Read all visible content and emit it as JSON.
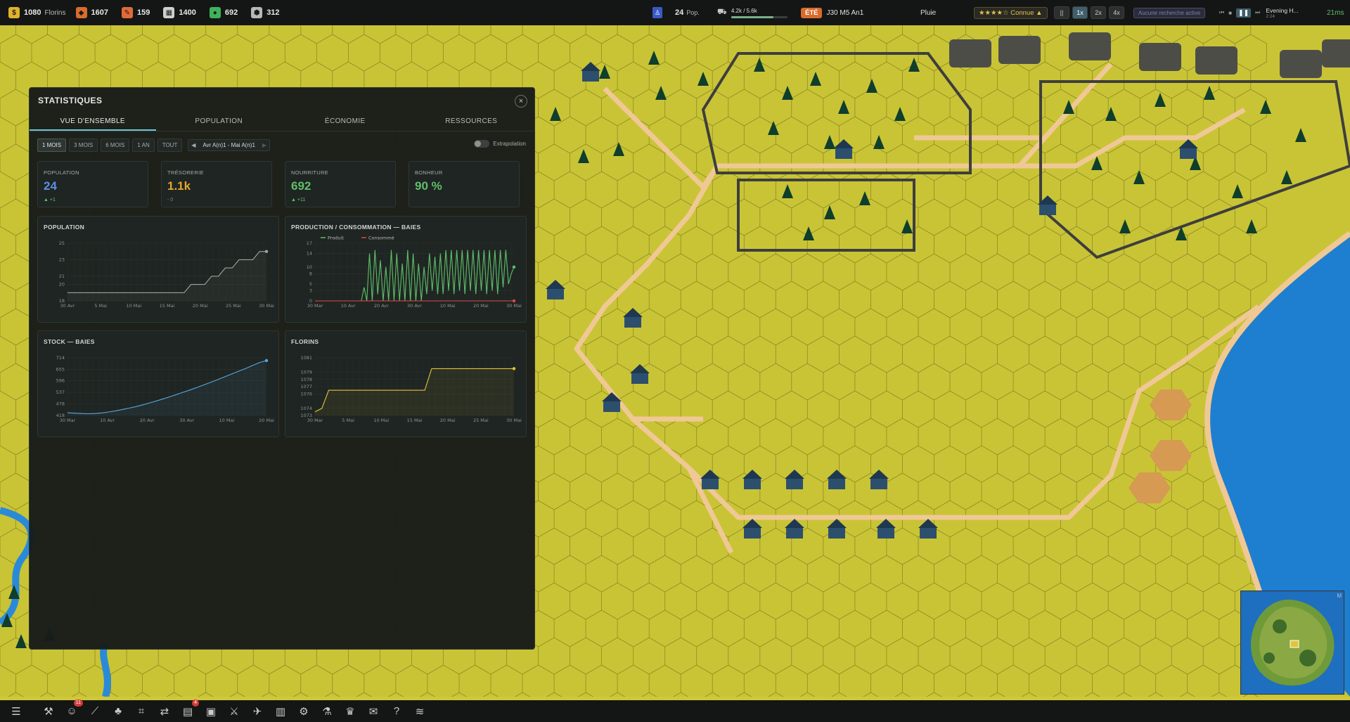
{
  "topbar": {
    "resources": [
      {
        "name": "florins",
        "icon": "coin-icon",
        "color": "#e0b22c",
        "value": "1080",
        "unit": "Florins"
      },
      {
        "name": "wood",
        "icon": "wood-icon",
        "color": "#d86c2c",
        "value": "1607",
        "unit": ""
      },
      {
        "name": "tools",
        "icon": "tools-icon",
        "color": "#e06a3a",
        "value": "159",
        "unit": ""
      },
      {
        "name": "stone",
        "icon": "stone-icon",
        "color": "#cfcfcf",
        "value": "1400",
        "unit": ""
      },
      {
        "name": "food",
        "icon": "food-icon",
        "color": "#3fb35a",
        "value": "692",
        "unit": ""
      },
      {
        "name": "metal",
        "icon": "metal-icon",
        "color": "#b8b8b8",
        "value": "312",
        "unit": ""
      }
    ],
    "population": {
      "value": "24",
      "unit": "Pop."
    },
    "storage": "4.2k / 5.6k",
    "season": "ÉTÉ",
    "date": "J30 M5 An1",
    "weather": "Pluie",
    "reputation": "★★★★☆ Connue ▲",
    "speed": {
      "pause": "||",
      "options": [
        "1x",
        "2x",
        "4x"
      ],
      "active": "1x"
    },
    "research": "Aucune recherche active",
    "track": {
      "title": "Evening H...",
      "time": "2:24"
    },
    "timer": "21ms"
  },
  "panel": {
    "title": "STATISTIQUES",
    "close": "×",
    "tabs": [
      "VUE D'ENSEMBLE",
      "POPULATION",
      "ÉCONOMIE",
      "RESSOURCES"
    ],
    "ranges": [
      "1 MOIS",
      "3 MOIS",
      "6 MOIS",
      "1 AN",
      "TOUT"
    ],
    "active_range": "1 MOIS",
    "period": "Avr A(n)1 - Mai A(n)1",
    "extrapolation": "Extrapolation",
    "cards": [
      {
        "label": "POPULATION",
        "value": "24",
        "delta": "▲ +1",
        "color": "#5b8ee6"
      },
      {
        "label": "TRÉSORERIE",
        "value": "1.1k",
        "delta": "- 0",
        "color": "#e3a82a"
      },
      {
        "label": "NOURRITURE",
        "value": "692",
        "delta": "▲ +11",
        "color": "#5fbf6a"
      },
      {
        "label": "BONHEUR",
        "value": "90 %",
        "delta": "",
        "color": "#5fbf6a"
      }
    ]
  },
  "chart_data": [
    {
      "type": "line",
      "title": "POPULATION",
      "x": [
        "30 Avr",
        "5 Mai",
        "10 Mai",
        "15 Mai",
        "20 Mai",
        "25 Mai",
        "30 Mai"
      ],
      "yticks": [
        18,
        20,
        21,
        23,
        25
      ],
      "ylim": [
        18,
        25
      ],
      "series": [
        {
          "values": [
            19,
            19,
            19,
            19,
            19,
            19,
            19,
            19,
            19,
            19,
            19,
            19,
            19,
            19,
            19,
            19,
            19,
            19,
            20,
            20,
            20,
            21,
            21,
            22,
            22,
            23,
            23,
            23,
            24,
            24
          ]
        }
      ],
      "color": "#9fa4a2"
    },
    {
      "type": "line",
      "title": "PRODUCTION / CONSOMMATION — BAIES",
      "x": [
        "30 Mar",
        "10 Avr",
        "20 Avr",
        "30 Avr",
        "10 Mai",
        "20 Mai",
        "30 Mai"
      ],
      "yticks": [
        0,
        3,
        5,
        8,
        10,
        14,
        17
      ],
      "ylim": [
        0,
        17
      ],
      "series": [
        {
          "name": "Produit",
          "color": "#5fbf6a",
          "values": [
            0,
            0,
            0,
            0,
            0,
            0,
            0,
            0,
            0,
            0,
            0,
            0,
            0,
            0,
            0,
            0,
            0,
            0,
            4,
            0,
            14,
            0,
            15,
            2,
            12,
            0,
            10,
            0,
            15,
            0,
            14,
            0,
            11,
            0,
            15,
            0,
            14,
            0,
            11,
            0,
            10,
            2,
            14,
            3,
            13,
            2,
            14,
            2,
            15,
            3,
            15,
            2,
            15,
            3,
            15,
            2,
            15,
            3,
            15,
            2,
            15,
            3,
            15,
            2,
            15,
            3,
            15,
            2,
            15,
            4,
            15,
            5,
            8,
            10
          ]
        },
        {
          "name": "Consommé",
          "color": "#e0474b",
          "values": [
            0,
            0,
            0,
            0,
            0,
            0,
            0,
            0,
            0,
            0,
            0,
            0,
            0,
            0,
            0,
            0,
            0,
            0,
            0,
            0,
            0,
            0,
            0,
            0,
            0,
            0,
            0,
            0,
            0,
            0,
            0,
            0,
            0,
            0,
            0,
            0,
            0,
            0,
            0,
            0,
            0,
            0,
            0,
            0,
            0,
            0,
            0,
            0,
            0,
            0,
            0,
            0,
            0,
            0,
            0,
            0,
            0,
            0,
            0,
            0,
            0,
            0,
            0,
            0,
            0,
            0,
            0,
            0,
            0,
            0,
            0,
            0,
            0,
            0
          ]
        }
      ]
    },
    {
      "type": "line",
      "title": "STOCK — BAIES",
      "x": [
        "30 Mar",
        "10 Avr",
        "20 Avr",
        "30 Avr",
        "10 Mai",
        "20 Mai"
      ],
      "yticks": [
        418,
        478,
        537,
        596,
        655,
        714
      ],
      "ylim": [
        418,
        714
      ],
      "series": [
        {
          "values": [
            432,
            430,
            428,
            427,
            428,
            431,
            436,
            442,
            449,
            456,
            464,
            473,
            483,
            493,
            504,
            515,
            527,
            539,
            551,
            564,
            577,
            590,
            604,
            618,
            632,
            646,
            660,
            675,
            690,
            700
          ]
        }
      ],
      "color": "#5aa7e0"
    },
    {
      "type": "line",
      "title": "FLORINS",
      "x": [
        "30 Mar",
        "5 Mai",
        "10 Mai",
        "15 Mai",
        "20 Mai",
        "25 Mai",
        "30 Mai"
      ],
      "yticks": [
        1073,
        1074,
        1076,
        1077,
        1078,
        1079,
        1081
      ],
      "ylim": [
        1073,
        1081
      ],
      "series": [
        {
          "values": [
            1073.5,
            1074,
            1076.5,
            1076.5,
            1076.5,
            1076.5,
            1076.5,
            1076.5,
            1076.5,
            1076.5,
            1076.5,
            1076.5,
            1076.5,
            1076.5,
            1076.5,
            1076.5,
            1076.5,
            1079.5,
            1079.5,
            1079.5,
            1079.5,
            1079.5,
            1079.5,
            1079.5,
            1079.5,
            1079.5,
            1079.5,
            1079.5,
            1079.5,
            1079.5
          ]
        }
      ],
      "color": "#e3c43a"
    }
  ],
  "bottombar": {
    "buttons": [
      {
        "icon": "menu-icon",
        "glyph": "☰",
        "badge": ""
      },
      {
        "icon": "build-icon",
        "glyph": "⚒",
        "badge": ""
      },
      {
        "icon": "citizens-icon",
        "glyph": "☺",
        "badge": "11"
      },
      {
        "icon": "road-icon",
        "glyph": "⟋",
        "badge": ""
      },
      {
        "icon": "tree-icon",
        "glyph": "♣",
        "badge": ""
      },
      {
        "icon": "farm-icon",
        "glyph": "⌗",
        "badge": ""
      },
      {
        "icon": "trade-icon",
        "glyph": "⇄",
        "badge": ""
      },
      {
        "icon": "book-icon",
        "glyph": "▤",
        "badge": "4"
      },
      {
        "icon": "storage-icon",
        "glyph": "▣",
        "badge": ""
      },
      {
        "icon": "military-icon",
        "glyph": "⚔",
        "badge": ""
      },
      {
        "icon": "bird-icon",
        "glyph": "✈",
        "badge": ""
      },
      {
        "icon": "wall-icon",
        "glyph": "▥",
        "badge": ""
      },
      {
        "icon": "settings-icon",
        "glyph": "⚙",
        "badge": ""
      },
      {
        "icon": "tech-icon",
        "glyph": "⚗",
        "badge": ""
      },
      {
        "icon": "trophy-icon",
        "glyph": "♛",
        "badge": ""
      },
      {
        "icon": "chat-icon",
        "glyph": "✉",
        "badge": ""
      },
      {
        "icon": "help-icon",
        "glyph": "?",
        "badge": ""
      },
      {
        "icon": "layers-icon",
        "glyph": "≋",
        "badge": ""
      }
    ]
  }
}
